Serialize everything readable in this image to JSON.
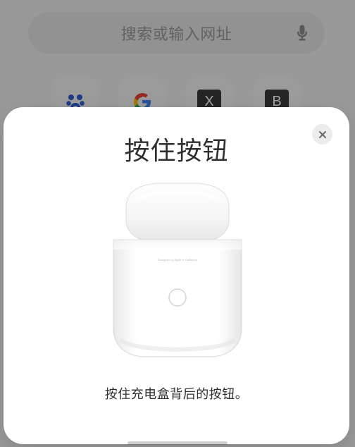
{
  "browser": {
    "search": {
      "placeholder": "搜索或输入网址",
      "voice_icon": "microphone-icon"
    },
    "shortcuts": [
      {
        "name": "baidu",
        "icon": "paw-icon"
      },
      {
        "name": "google",
        "icon": "google-icon"
      },
      {
        "name": "x",
        "tile_text": "X"
      },
      {
        "name": "b",
        "tile_text": "B"
      }
    ]
  },
  "modal": {
    "title": "按住按钮",
    "close_icon": "close-icon",
    "illustration": "airpods-charging-case",
    "case_engraving": "Designed by Apple in California",
    "description": "按住充电盒背后的按钮。"
  },
  "colors": {
    "overlay": "#000000",
    "sheet": "#ffffff",
    "text": "#2f2f2f",
    "close_button_bg": "#ececec"
  }
}
